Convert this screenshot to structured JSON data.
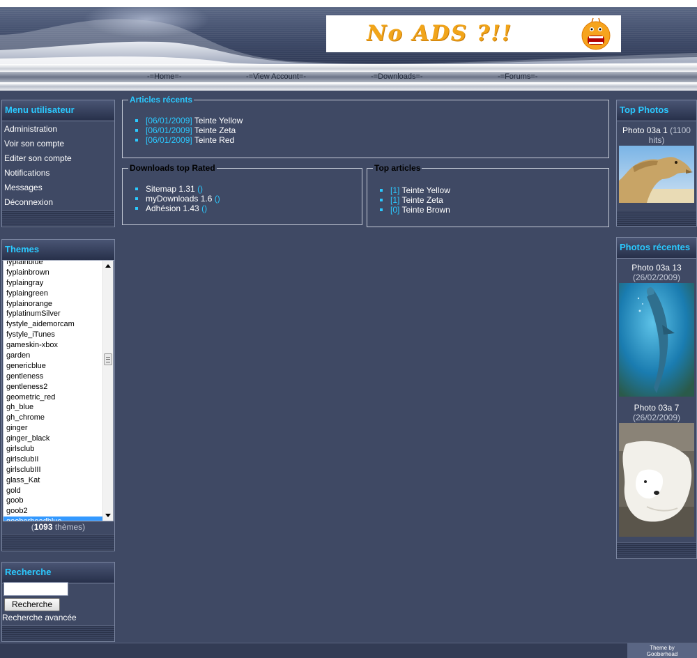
{
  "ad": {
    "text": "No ADS ?!!"
  },
  "nav": [
    {
      "label": "-=Home=-"
    },
    {
      "label": "-=View Account=-"
    },
    {
      "label": "-=Downloads=-"
    },
    {
      "label": "-=Forums=-"
    }
  ],
  "user_menu": {
    "title": "Menu utilisateur",
    "items": [
      "Administration",
      "Voir son compte",
      "Editer son compte",
      "Notifications",
      "Messages",
      "Déconnexion"
    ]
  },
  "themes": {
    "title": "Themes",
    "items": [
      "fyplainblue",
      "fyplainbrown",
      "fyplaingray",
      "fyplaingreen",
      "fyplainorange",
      "fyplatinumSilver",
      "fystyle_aidemorcam",
      "fystyle_iTunes",
      "gameskin-xbox",
      "garden",
      "genericblue",
      "gentleness",
      "gentleness2",
      "geometric_red",
      "gh_blue",
      "gh_chrome",
      "ginger",
      "ginger_black",
      "girlsclub",
      "girlsclubII",
      "girlsclubIII",
      "glass_Kat",
      "gold",
      "goob",
      "goob2",
      "gooberheadblue"
    ],
    "selected": "gooberheadblue",
    "count_open": "(",
    "count": "1093",
    "count_suffix": " thèmes)"
  },
  "search": {
    "title": "Recherche",
    "input_value": "",
    "button_label": "Recherche",
    "advanced_label": "Recherche avancée"
  },
  "recent_articles": {
    "title": "Articles récents",
    "items": [
      {
        "date": "[06/01/2009]",
        "name": "Teinte Yellow"
      },
      {
        "date": "[06/01/2009]",
        "name": "Teinte Zeta"
      },
      {
        "date": "[06/01/2009]",
        "name": "Teinte Red"
      }
    ]
  },
  "downloads_top": {
    "title": "Downloads top Rated",
    "items": [
      {
        "name": "Sitemap 1.31",
        "rating": "()"
      },
      {
        "name": "myDownloads 1.6",
        "rating": "()"
      },
      {
        "name": "Adhésion 1.43",
        "rating": "()"
      }
    ]
  },
  "top_articles": {
    "title": "Top articles",
    "items": [
      {
        "count": "[1]",
        "name": "Teinte Yellow"
      },
      {
        "count": "[1]",
        "name": "Teinte Zeta"
      },
      {
        "count": "[0]",
        "name": "Teinte Brown"
      }
    ]
  },
  "top_photos": {
    "title": "Top Photos",
    "photo": {
      "name": "Photo 03a 1",
      "hits": "(1100 hits)",
      "icon": "camel-photo"
    }
  },
  "recent_photos": {
    "title": "Photos récentes",
    "items": [
      {
        "name": "Photo 03a 13",
        "date": "(26/02/2009)",
        "icon": "dolphin-photo"
      },
      {
        "name": "Photo 03a 7",
        "date": "(26/02/2009)",
        "icon": "polar-bear-photo"
      }
    ]
  },
  "footer": {
    "credit_line1": "Theme by",
    "credit_line2": "Gooberhead"
  },
  "colors": {
    "background": "#3f4964",
    "accent": "#2bc9ff",
    "selected": "#3399ff"
  }
}
